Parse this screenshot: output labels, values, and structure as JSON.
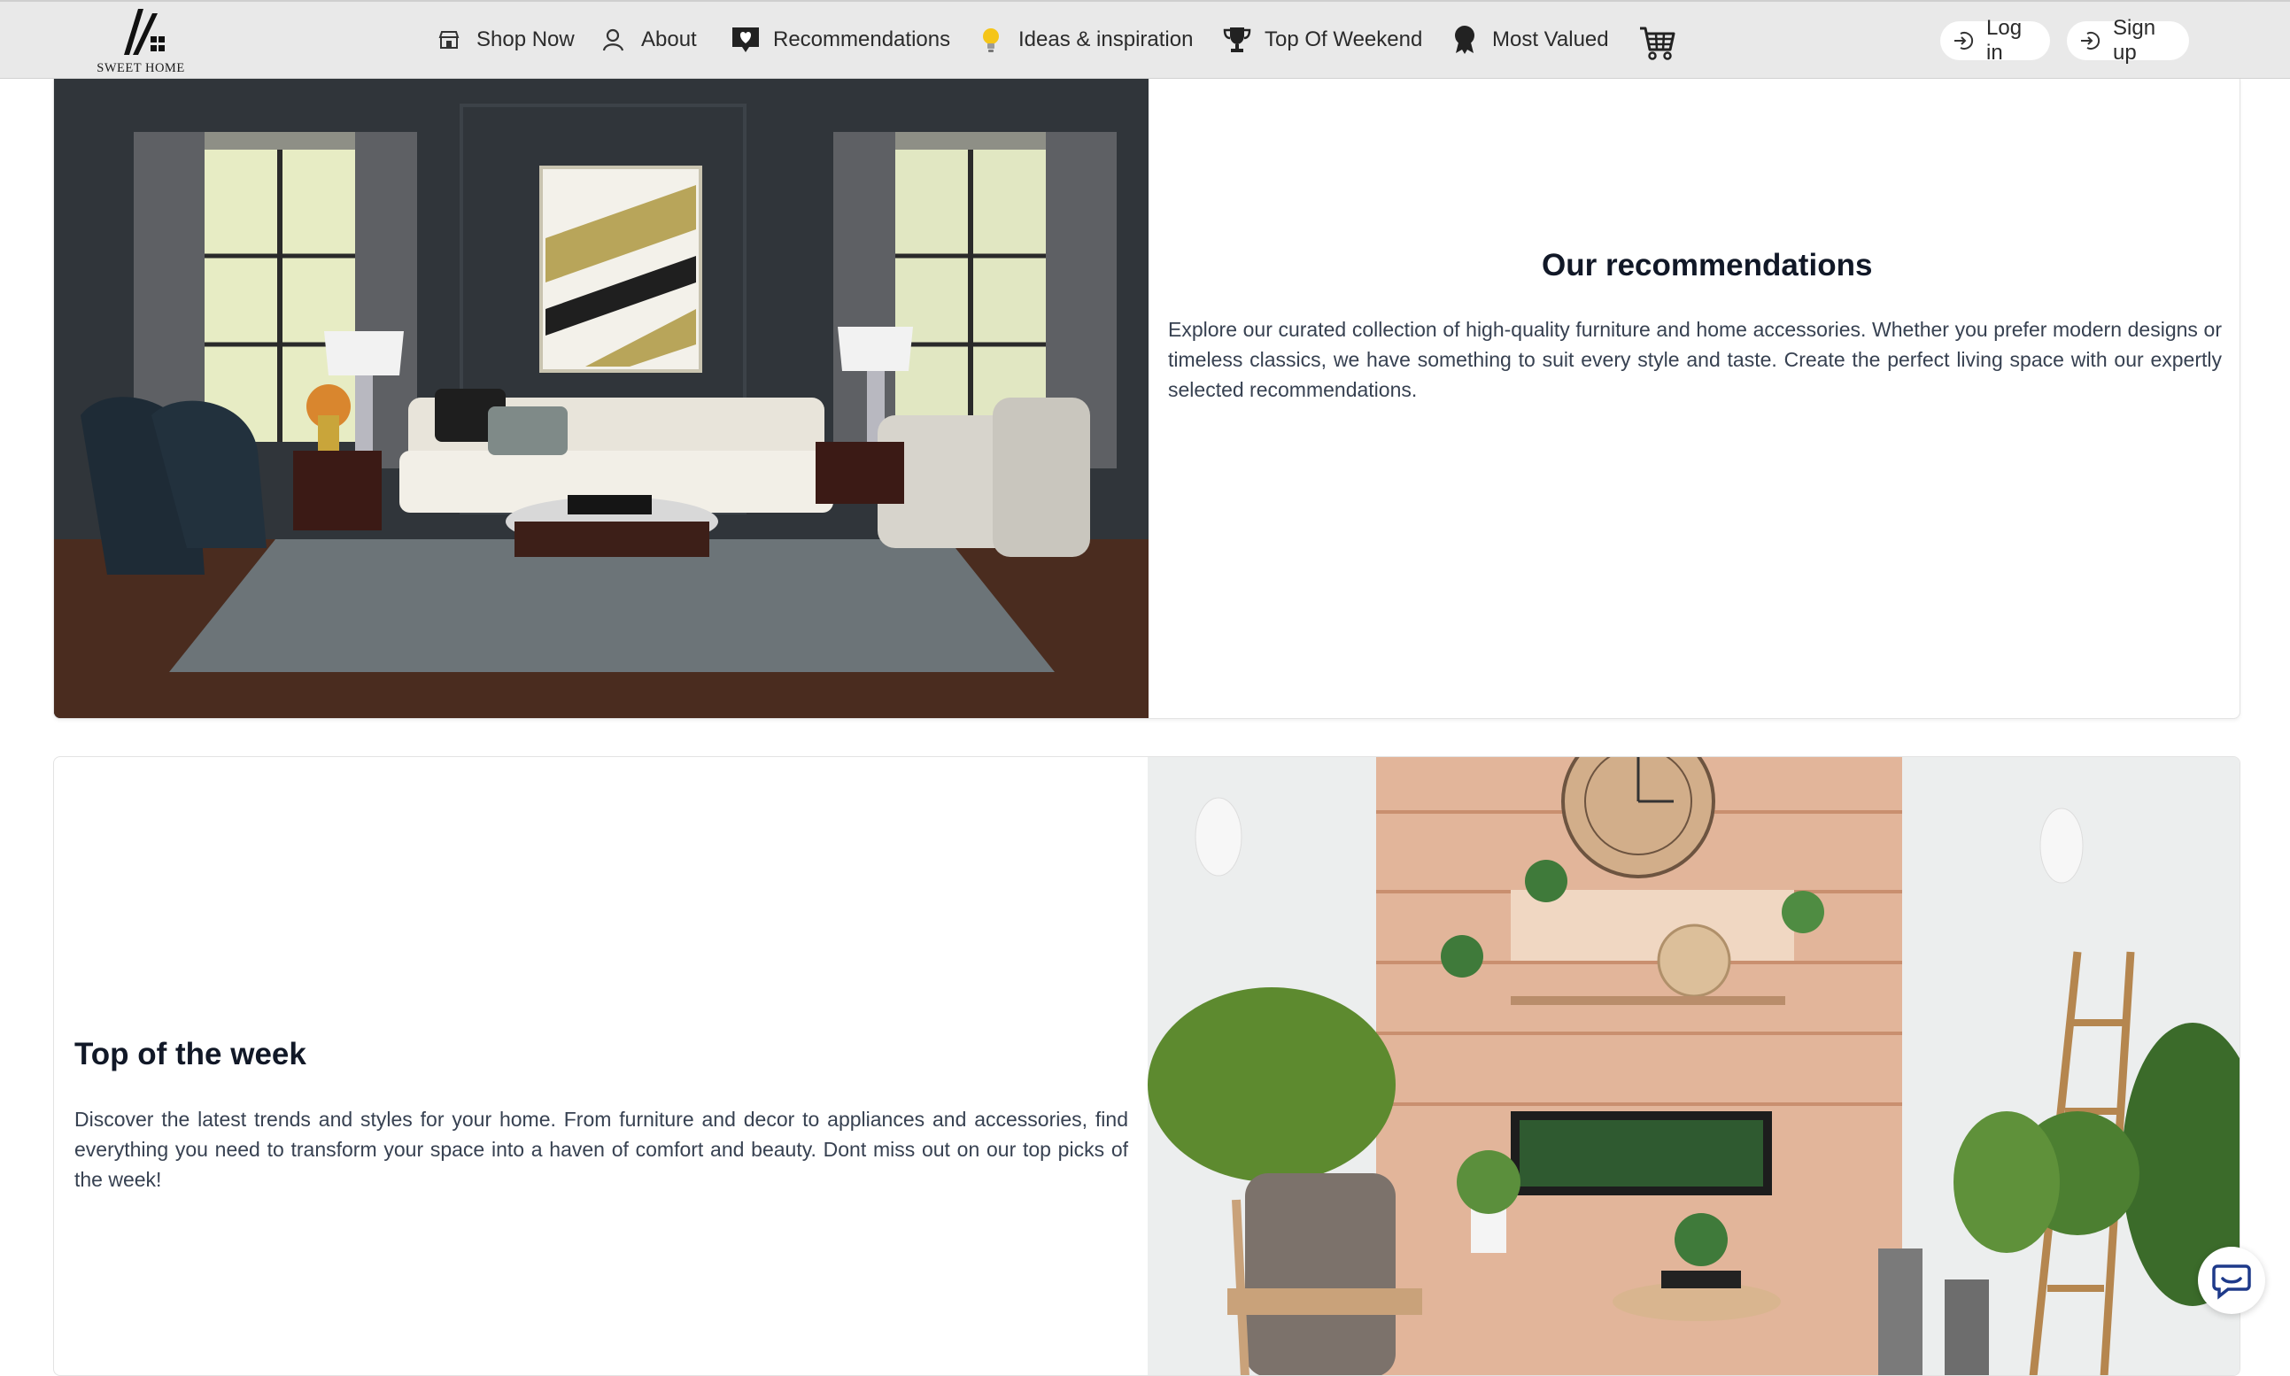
{
  "brand": {
    "name": "SWEET HOME"
  },
  "nav": {
    "items": [
      {
        "label": "Shop Now",
        "icon": "store-icon"
      },
      {
        "label": "About",
        "icon": "person-icon"
      },
      {
        "label": "Recommendations",
        "icon": "heart-chat-icon"
      },
      {
        "label": "Ideas & inspiration",
        "icon": "lightbulb-icon"
      },
      {
        "label": "Top Of Weekend",
        "icon": "trophy-icon"
      },
      {
        "label": "Most Valued",
        "icon": "award-icon"
      }
    ],
    "cart_icon": "cart-icon",
    "login_label": "Log in",
    "signup_label": "Sign up"
  },
  "sections": {
    "recommendations": {
      "title": "Our recommendations",
      "description": "Explore our curated collection of high-quality furniture and home accessories. Whether you prefer modern designs or timeless classics, we have something to suit every style and taste. Create the perfect living space with our expertly selected recommendations."
    },
    "top_week": {
      "title": "Top of the week",
      "description": "Discover the latest trends and styles for your home. From furniture and decor to appliances and accessories, find everything you need to transform your space into a haven of comfort and beauty. Dont miss out on our top picks of the week!"
    }
  },
  "colors": {
    "navbar_bg": "#e9e9e9",
    "chat_accent": "#1e3a8a",
    "title": "#111827",
    "text": "#374151"
  }
}
